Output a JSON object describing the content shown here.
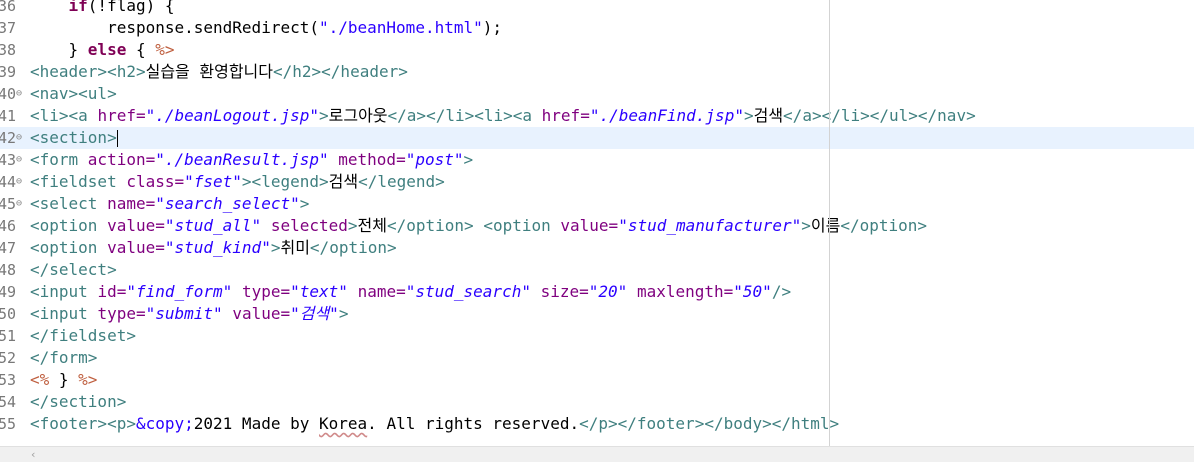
{
  "editor": {
    "lines": [
      {
        "num": "36",
        "fold": false,
        "tokens": [
          {
            "t": "    ",
            "c": "text"
          },
          {
            "t": "if",
            "c": "kw"
          },
          {
            "t": "(!flag) {",
            "c": "text"
          }
        ]
      },
      {
        "num": "37",
        "fold": false,
        "tokens": [
          {
            "t": "        response.sendRedirect(",
            "c": "text"
          },
          {
            "t": "\"./beanHome.html\"",
            "c": "jstr"
          },
          {
            "t": ");",
            "c": "text"
          }
        ]
      },
      {
        "num": "38",
        "fold": false,
        "tokens": [
          {
            "t": "    } ",
            "c": "text"
          },
          {
            "t": "else",
            "c": "kw"
          },
          {
            "t": " { ",
            "c": "text"
          },
          {
            "t": "%>",
            "c": "scr"
          }
        ]
      },
      {
        "num": "39",
        "fold": false,
        "tokens": [
          {
            "t": "<header><h2>",
            "c": "tag"
          },
          {
            "t": "실습을 환영합니다",
            "c": "text"
          },
          {
            "t": "</h2></header>",
            "c": "tag"
          }
        ]
      },
      {
        "num": "40",
        "fold": true,
        "tokens": [
          {
            "t": "<nav><ul>",
            "c": "tag"
          }
        ]
      },
      {
        "num": "41",
        "fold": false,
        "tokens": [
          {
            "t": "<li><a ",
            "c": "tag"
          },
          {
            "t": "href=",
            "c": "attr"
          },
          {
            "t": "\"./beanLogout.jsp\"",
            "c": "str"
          },
          {
            "t": ">",
            "c": "tag"
          },
          {
            "t": "로그아웃",
            "c": "text"
          },
          {
            "t": "</a></li><li><a ",
            "c": "tag"
          },
          {
            "t": "href=",
            "c": "attr"
          },
          {
            "t": "\"./beanFind.jsp\"",
            "c": "str"
          },
          {
            "t": ">",
            "c": "tag"
          },
          {
            "t": "검색",
            "c": "text"
          },
          {
            "t": "</a></li></ul></nav>",
            "c": "tag"
          }
        ]
      },
      {
        "num": "42",
        "fold": true,
        "current": true,
        "tokens": [
          {
            "t": "<section>",
            "c": "tag"
          }
        ]
      },
      {
        "num": "43",
        "fold": true,
        "tokens": [
          {
            "t": "<form ",
            "c": "tag"
          },
          {
            "t": "action=",
            "c": "attr"
          },
          {
            "t": "\"./beanResult.jsp\"",
            "c": "str"
          },
          {
            "t": " ",
            "c": "text"
          },
          {
            "t": "method=",
            "c": "attr"
          },
          {
            "t": "\"post\"",
            "c": "str"
          },
          {
            "t": ">",
            "c": "tag"
          }
        ]
      },
      {
        "num": "44",
        "fold": true,
        "tokens": [
          {
            "t": "<fieldset ",
            "c": "tag"
          },
          {
            "t": "class=",
            "c": "attr"
          },
          {
            "t": "\"fset\"",
            "c": "str"
          },
          {
            "t": "><legend>",
            "c": "tag"
          },
          {
            "t": "검색",
            "c": "text"
          },
          {
            "t": "</legend>",
            "c": "tag"
          }
        ]
      },
      {
        "num": "45",
        "fold": true,
        "tokens": [
          {
            "t": "<select ",
            "c": "tag"
          },
          {
            "t": "name=",
            "c": "attr"
          },
          {
            "t": "\"search_select\"",
            "c": "str"
          },
          {
            "t": ">",
            "c": "tag"
          }
        ]
      },
      {
        "num": "46",
        "fold": false,
        "tokens": [
          {
            "t": "<option ",
            "c": "tag"
          },
          {
            "t": "value=",
            "c": "attr"
          },
          {
            "t": "\"stud_all\"",
            "c": "str"
          },
          {
            "t": " ",
            "c": "text"
          },
          {
            "t": "selected",
            "c": "attr"
          },
          {
            "t": ">",
            "c": "tag"
          },
          {
            "t": "전체",
            "c": "text"
          },
          {
            "t": "</option>",
            "c": "tag"
          },
          {
            "t": " ",
            "c": "text"
          },
          {
            "t": "<option ",
            "c": "tag"
          },
          {
            "t": "value=",
            "c": "attr"
          },
          {
            "t": "\"stud_manufacturer\"",
            "c": "str"
          },
          {
            "t": ">",
            "c": "tag"
          },
          {
            "t": "이름",
            "c": "text"
          },
          {
            "t": "</option>",
            "c": "tag"
          }
        ]
      },
      {
        "num": "47",
        "fold": false,
        "tokens": [
          {
            "t": "<option ",
            "c": "tag"
          },
          {
            "t": "value=",
            "c": "attr"
          },
          {
            "t": "\"stud_kind\"",
            "c": "str"
          },
          {
            "t": ">",
            "c": "tag"
          },
          {
            "t": "취미",
            "c": "text"
          },
          {
            "t": "</option>",
            "c": "tag"
          }
        ]
      },
      {
        "num": "48",
        "fold": false,
        "tokens": [
          {
            "t": "</select>",
            "c": "tag"
          }
        ]
      },
      {
        "num": "49",
        "fold": false,
        "tokens": [
          {
            "t": "<input ",
            "c": "tag"
          },
          {
            "t": "id=",
            "c": "attr"
          },
          {
            "t": "\"find_form\"",
            "c": "str"
          },
          {
            "t": " ",
            "c": "text"
          },
          {
            "t": "type=",
            "c": "attr"
          },
          {
            "t": "\"text\"",
            "c": "str"
          },
          {
            "t": " ",
            "c": "text"
          },
          {
            "t": "name=",
            "c": "attr"
          },
          {
            "t": "\"stud_search\"",
            "c": "str"
          },
          {
            "t": " ",
            "c": "text"
          },
          {
            "t": "size=",
            "c": "attr"
          },
          {
            "t": "\"20\"",
            "c": "str"
          },
          {
            "t": " ",
            "c": "text"
          },
          {
            "t": "maxlength=",
            "c": "attr"
          },
          {
            "t": "\"50\"",
            "c": "str"
          },
          {
            "t": "/>",
            "c": "tag"
          }
        ]
      },
      {
        "num": "50",
        "fold": false,
        "tokens": [
          {
            "t": "<input ",
            "c": "tag"
          },
          {
            "t": "type=",
            "c": "attr"
          },
          {
            "t": "\"submit\"",
            "c": "str"
          },
          {
            "t": " ",
            "c": "text"
          },
          {
            "t": "value=",
            "c": "attr"
          },
          {
            "t": "\"검색\"",
            "c": "str"
          },
          {
            "t": ">",
            "c": "tag"
          }
        ]
      },
      {
        "num": "51",
        "fold": false,
        "tokens": [
          {
            "t": "</fieldset>",
            "c": "tag"
          }
        ]
      },
      {
        "num": "52",
        "fold": false,
        "tokens": [
          {
            "t": "</form>",
            "c": "tag"
          }
        ]
      },
      {
        "num": "53",
        "fold": false,
        "tokens": [
          {
            "t": "<%",
            "c": "scr"
          },
          {
            "t": " } ",
            "c": "text"
          },
          {
            "t": "%>",
            "c": "scr"
          }
        ]
      },
      {
        "num": "54",
        "fold": false,
        "tokens": [
          {
            "t": "</section>",
            "c": "tag"
          }
        ]
      },
      {
        "num": "55",
        "fold": false,
        "tokens": [
          {
            "t": "<footer><p>",
            "c": "tag"
          },
          {
            "t": "&copy;",
            "c": "ent"
          },
          {
            "t": "2021 Made by ",
            "c": "text"
          },
          {
            "t": "Korea",
            "c": "squiggle"
          },
          {
            "t": ". All rights reserved.",
            "c": "text"
          },
          {
            "t": "</p></footer></body></html>",
            "c": "tag"
          }
        ]
      }
    ],
    "colors": {
      "keyword": "#7f0055",
      "tag": "#3f7f7f",
      "attribute": "#7f007f",
      "string": "#2a00ff",
      "scriptlet": "#bf5f3f",
      "current_line": "#e8f2fe"
    }
  }
}
